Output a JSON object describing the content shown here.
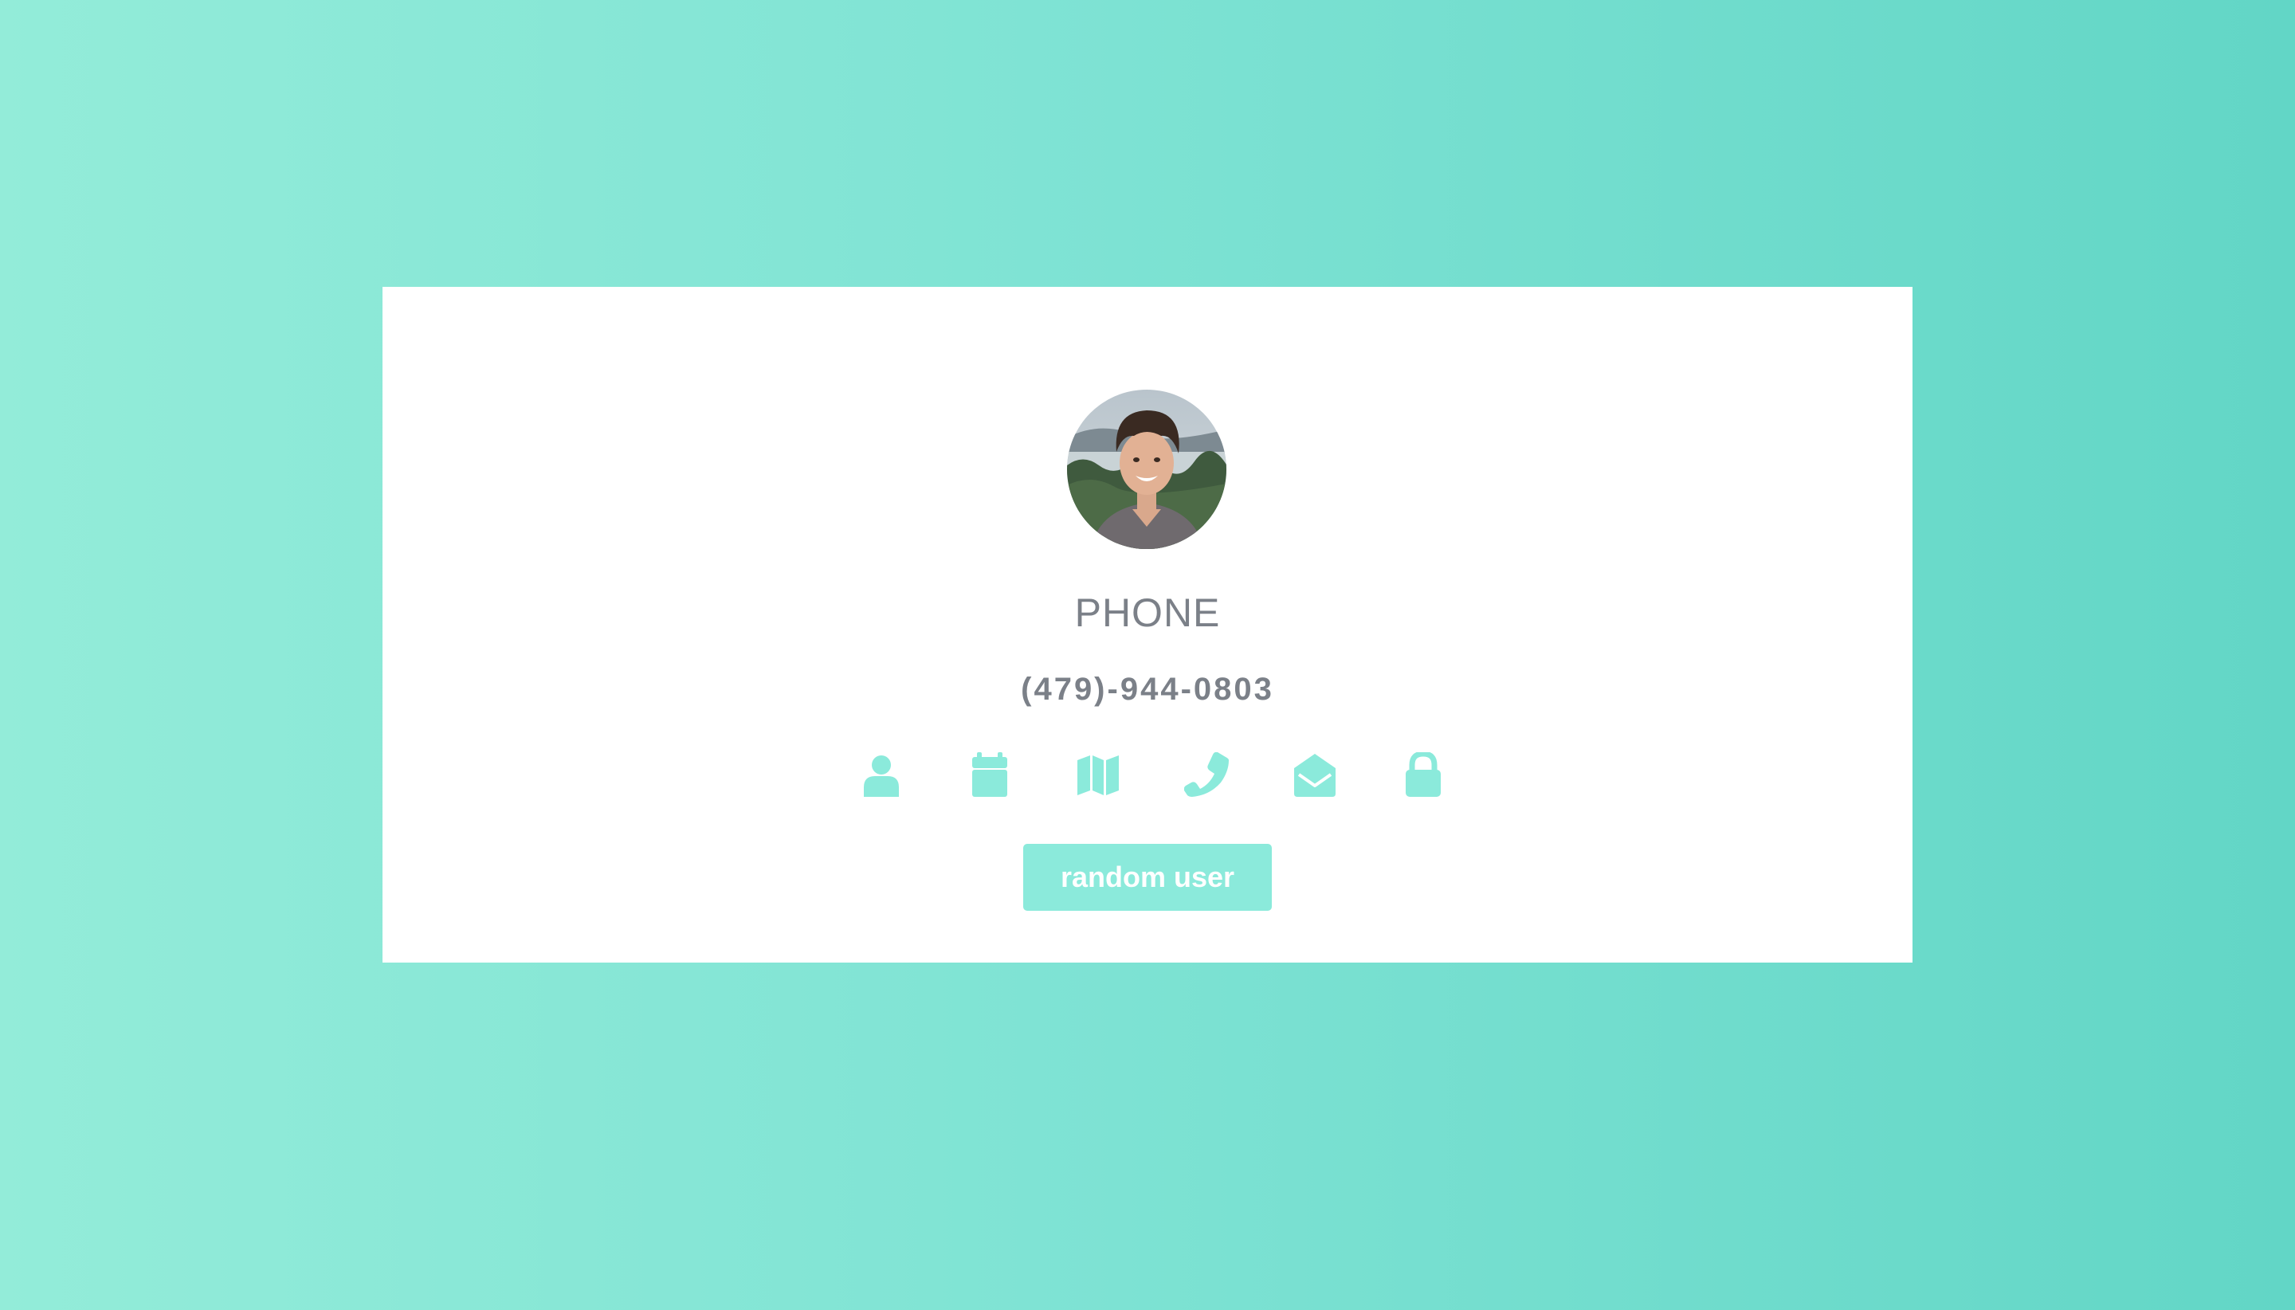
{
  "colors": {
    "accent": "#8beadb",
    "text": "#7b8088",
    "card_bg": "#ffffff",
    "bg_gradient_start": "#93ecd9",
    "bg_gradient_end": "#62d6c6"
  },
  "profile": {
    "title": "PHONE",
    "value": "(479)-944-0803"
  },
  "icons": [
    {
      "name": "user-icon"
    },
    {
      "name": "calendar-icon"
    },
    {
      "name": "map-icon"
    },
    {
      "name": "phone-icon"
    },
    {
      "name": "envelope-open-icon"
    },
    {
      "name": "lock-icon"
    }
  ],
  "button": {
    "label": "random user"
  }
}
